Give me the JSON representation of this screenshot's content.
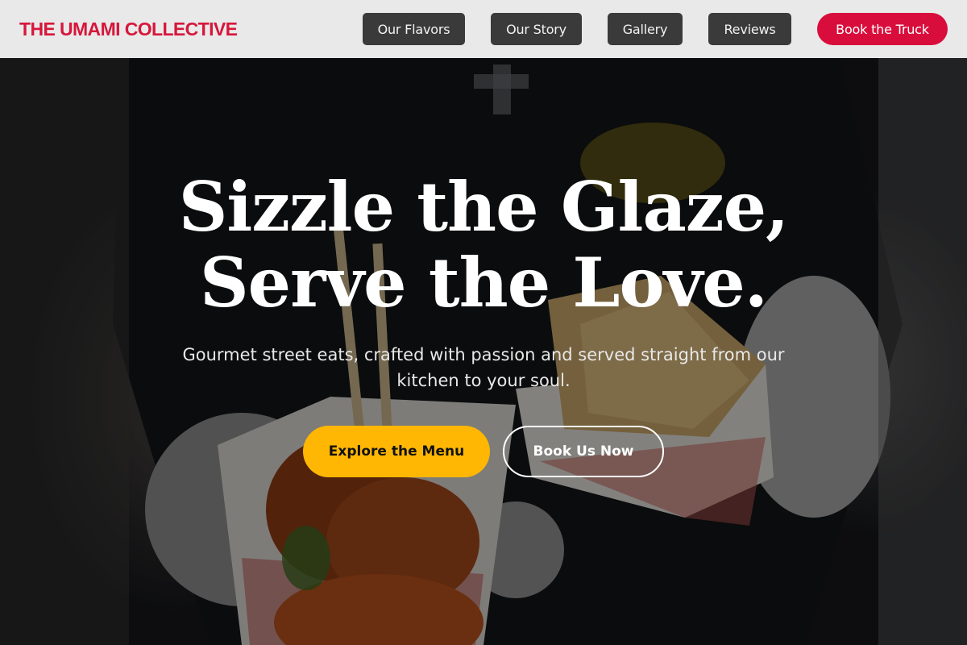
{
  "brand": {
    "name": "THE UMAMI COLLECTIVE"
  },
  "nav": {
    "items": [
      {
        "label": "Our Flavors"
      },
      {
        "label": "Our Story"
      },
      {
        "label": "Gallery"
      },
      {
        "label": "Reviews"
      }
    ],
    "book_label": "Book the Truck"
  },
  "hero": {
    "headline_line1": "Sizzle the Glaze,",
    "headline_line2": "Serve the Love.",
    "subtitle": "Gourmet street eats, crafted with passion and served straight from our kitchen to your soul.",
    "primary_cta": "Explore the Menu",
    "secondary_cta": "Book Us Now",
    "background_image": "food-truck-worker-holding-meatballs-and-samosas"
  },
  "colors": {
    "brand_red": "#d6173b",
    "accent_yellow": "#ffb703",
    "nav_button_bg": "#3a3a3a",
    "header_bg": "#e9e9e9"
  }
}
